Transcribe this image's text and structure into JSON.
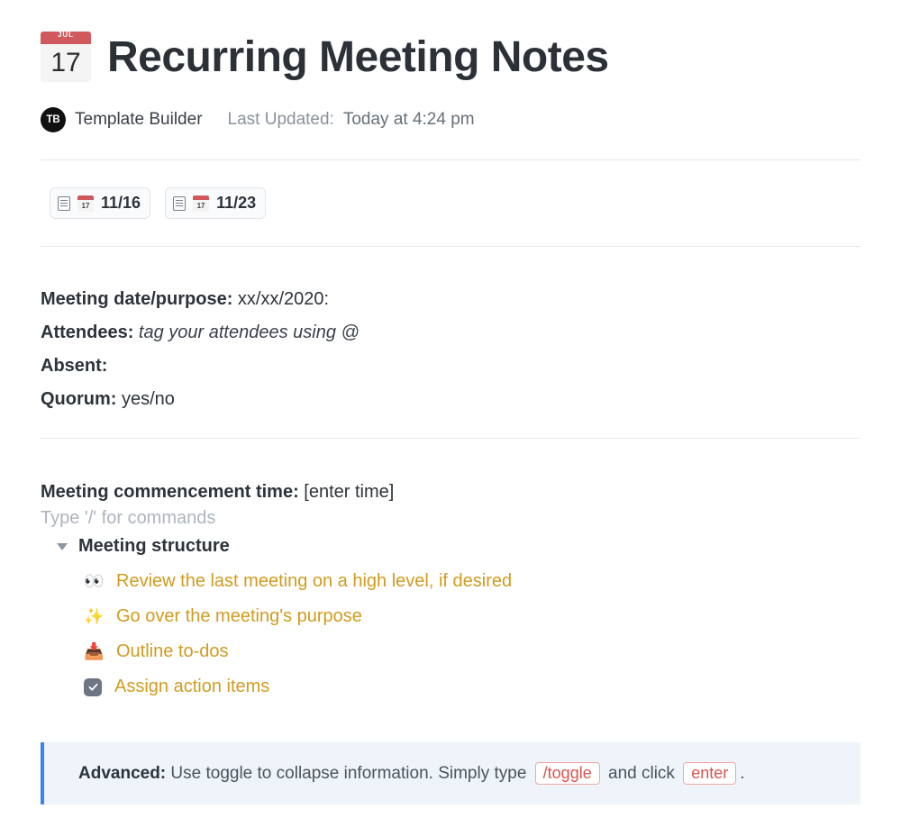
{
  "title": {
    "icon_month": "JUL",
    "icon_day": "17",
    "text": "Recurring Meeting Notes"
  },
  "meta": {
    "avatar_initials": "TB",
    "author": "Template Builder",
    "updated_label": "Last Updated:",
    "updated_value": "Today at 4:24 pm"
  },
  "subpages": [
    {
      "icon_day": "17",
      "label": "11/16"
    },
    {
      "icon_day": "17",
      "label": "11/23"
    }
  ],
  "info": {
    "date_label": "Meeting date/purpose:",
    "date_value": "xx/xx/2020:",
    "attendees_label": "Attendees:",
    "attendees_placeholder": "tag your attendees using @",
    "absent_label": "Absent:",
    "quorum_label": "Quorum:",
    "quorum_value": "yes/no"
  },
  "commence": {
    "label": "Meeting commencement time:",
    "value": "[enter time]",
    "slash_hint": "Type '/' for commands"
  },
  "structure": {
    "toggle_title": "Meeting structure",
    "items": [
      {
        "emoji": "👀",
        "text": "Review the last meeting on a high level, if desired"
      },
      {
        "emoji": "✨",
        "text": "Go over the meeting's purpose"
      },
      {
        "emoji": "📥",
        "text": "Outline to-dos"
      },
      {
        "emoji": "check",
        "text": "Assign action items"
      }
    ]
  },
  "callout": {
    "label": "Advanced:",
    "text_before": " Use toggle to collapse information. Simply type ",
    "kbd1": "/toggle",
    "text_mid": " and click ",
    "kbd2": "enter",
    "text_after": "."
  }
}
